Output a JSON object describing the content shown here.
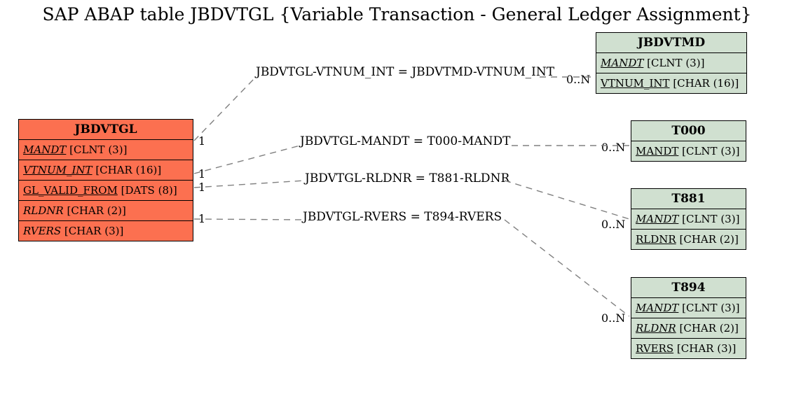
{
  "title": "SAP ABAP table JBDVTGL {Variable Transaction - General Ledger Assignment}",
  "main_entity": {
    "name": "JBDVTGL",
    "fields": [
      {
        "label": "MANDT",
        "type": "[CLNT (3)]",
        "style": "fk"
      },
      {
        "label": "VTNUM_INT",
        "type": "[CHAR (16)]",
        "style": "fk"
      },
      {
        "label": "GL_VALID_FROM",
        "type": "[DATS (8)]",
        "style": "pk"
      },
      {
        "label": "RLDNR",
        "type": "[CHAR (2)]",
        "style": "plain-italic"
      },
      {
        "label": "RVERS",
        "type": "[CHAR (3)]",
        "style": "plain-italic"
      }
    ]
  },
  "ref_entities": [
    {
      "name": "JBDVTMD",
      "fields": [
        {
          "label": "MANDT",
          "type": "[CLNT (3)]",
          "style": "fk"
        },
        {
          "label": "VTNUM_INT",
          "type": "[CHAR (16)]",
          "style": "pk"
        }
      ]
    },
    {
      "name": "T000",
      "fields": [
        {
          "label": "MANDT",
          "type": "[CLNT (3)]",
          "style": "pk"
        }
      ]
    },
    {
      "name": "T881",
      "fields": [
        {
          "label": "MANDT",
          "type": "[CLNT (3)]",
          "style": "fk"
        },
        {
          "label": "RLDNR",
          "type": "[CHAR (2)]",
          "style": "pk"
        }
      ]
    },
    {
      "name": "T894",
      "fields": [
        {
          "label": "MANDT",
          "type": "[CLNT (3)]",
          "style": "fk"
        },
        {
          "label": "RLDNR",
          "type": "[CHAR (2)]",
          "style": "fk"
        },
        {
          "label": "RVERS",
          "type": "[CHAR (3)]",
          "style": "pk"
        }
      ]
    }
  ],
  "relations": [
    {
      "label": "JBDVTGL-VTNUM_INT = JBDVTMD-VTNUM_INT",
      "left_card": "1",
      "right_card": "0..N"
    },
    {
      "label": "JBDVTGL-MANDT = T000-MANDT",
      "left_card": "1",
      "right_card": "0..N"
    },
    {
      "label": "JBDVTGL-RLDNR = T881-RLDNR",
      "left_card": "1",
      "right_card": ""
    },
    {
      "label": "JBDVTGL-RVERS = T894-RVERS",
      "left_card": "1",
      "right_card": "0..N"
    }
  ],
  "extra_cards": {
    "t894_right": "0..N"
  }
}
